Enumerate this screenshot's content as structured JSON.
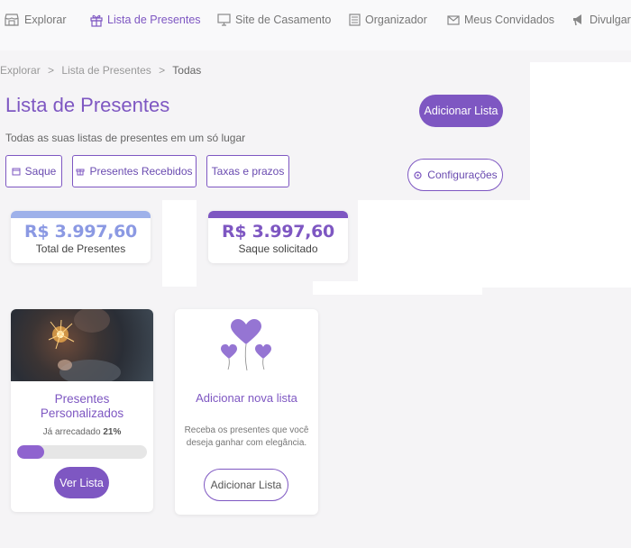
{
  "nav": {
    "items": [
      {
        "label": "Explorar",
        "icon": "store-icon",
        "active": false
      },
      {
        "label": "Lista de Presentes",
        "icon": "gift-icon",
        "active": true
      },
      {
        "label": "Site de Casamento",
        "icon": "monitor-icon",
        "active": false
      },
      {
        "label": "Organizador",
        "icon": "notebook-icon",
        "active": false
      },
      {
        "label": "Meus Convidados",
        "icon": "envelope-icon",
        "active": false
      },
      {
        "label": "Divulgar",
        "icon": "megaphone-icon",
        "active": false
      }
    ]
  },
  "breadcrumb": {
    "root": "Explorar",
    "sep": ">",
    "middle": "Lista de Presentes",
    "current": "Todas"
  },
  "header": {
    "title": "Lista de Presentes",
    "subtitle": "Todas as suas listas de presentes em um só lugar",
    "add_list_button": "Adicionar Lista",
    "settings_button": "Configurações"
  },
  "tabs": [
    {
      "label": "Saque",
      "icon": "wallet-icon"
    },
    {
      "label": "Presentes Recebidos",
      "icon": "gift-icon"
    },
    {
      "label": "Taxas e prazos",
      "icon": ""
    }
  ],
  "stats": [
    {
      "value": "R$ 3.997,60",
      "label": "Total de Presentes",
      "color": "#8b99e3",
      "bar_color": "#9eb1ea"
    },
    {
      "value": "R$ 3.997,60",
      "label": "Saque solicitado",
      "color": "#7e57c2",
      "bar_color": "#7e57c2"
    }
  ],
  "cards": {
    "custom": {
      "title": "Presentes Personalizados",
      "raised_label": "Já arrecadado",
      "raised_pct": "21%",
      "progress": 0.21,
      "button": "Ver Lista"
    },
    "new_list": {
      "title": "Adicionar nova lista",
      "description": "Receba os presentes que você deseja ganhar com elegância.",
      "button": "Adicionar Lista"
    }
  },
  "colors": {
    "accent": "#7e57c2",
    "background": "#f5f4f6"
  }
}
